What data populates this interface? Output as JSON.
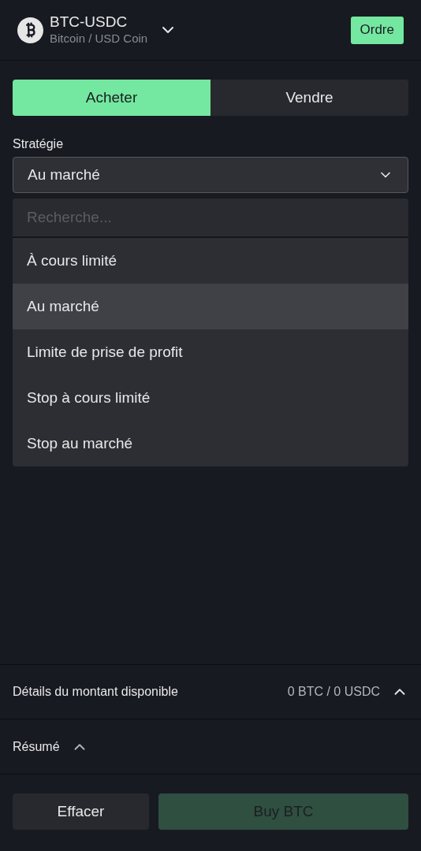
{
  "header": {
    "pair": "BTC-USDC",
    "subtitle": "Bitcoin / USD Coin",
    "order_button": "Ordre"
  },
  "side_tabs": [
    {
      "label": "Acheter",
      "selected": true
    },
    {
      "label": "Vendre",
      "selected": false
    }
  ],
  "strategy": {
    "label": "Stratégie",
    "value": "Au marché",
    "open": true,
    "search": {
      "placeholder": "Recherche..."
    },
    "options": [
      {
        "label": "À cours limité",
        "selected": false
      },
      {
        "label": "Au marché",
        "selected": true
      },
      {
        "label": "Limite de prise de profit",
        "selected": false
      },
      {
        "label": "Stop à cours limité",
        "selected": false
      },
      {
        "label": "Stop au marché",
        "selected": false
      }
    ]
  },
  "available": {
    "label": "Détails du montant disponible",
    "value": "0 BTC / 0 USDC"
  },
  "summary": {
    "label": "Résumé"
  },
  "footer": {
    "clear_button": "Effacer",
    "buy_button": {
      "label": "Buy BTC",
      "disabled": true
    }
  }
}
